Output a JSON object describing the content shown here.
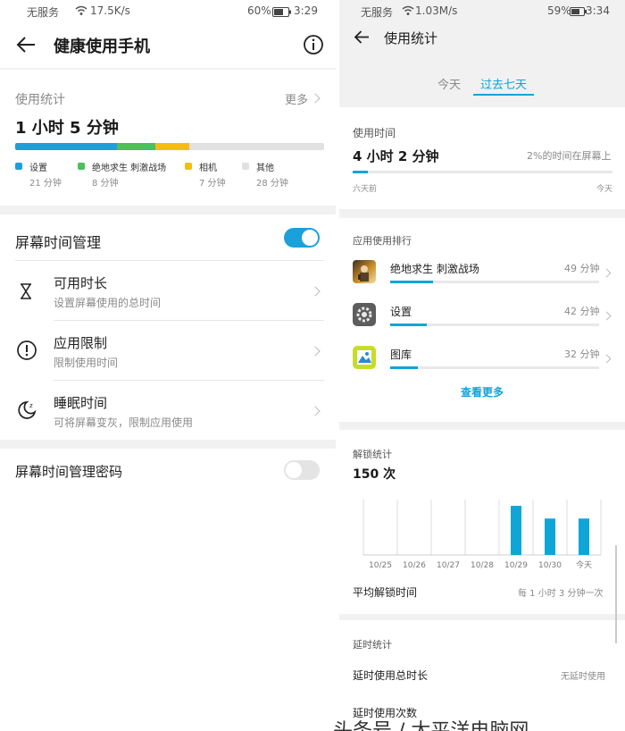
{
  "left": {
    "status_bar": {
      "carrier": "无服务",
      "speed": "17.5K/s",
      "battery": "60%",
      "time": "3:29"
    },
    "header": {
      "title": "健康使用手机"
    },
    "usage": {
      "label": "使用统计",
      "more": "更多",
      "total": "1 小时 5 分钟",
      "segments": [
        {
          "name": "设置",
          "minutes_label": "21 分钟",
          "minutes": 21,
          "color": "#1ba0dc"
        },
        {
          "name": "绝地求生 刺激战场",
          "minutes_label": "8 分钟",
          "minutes": 8,
          "color": "#4cc05a"
        },
        {
          "name": "相机",
          "minutes_label": "7 分钟",
          "minutes": 7,
          "color": "#f1be14"
        },
        {
          "name": "其他",
          "minutes_label": "28 分钟",
          "minutes": 28,
          "color": "#e1e1e1"
        }
      ]
    },
    "screen_time": {
      "title": "屏幕时间管理",
      "enabled": true,
      "items": [
        {
          "title": "可用时长",
          "subtitle": "设置屏幕使用的总时间",
          "icon": "hourglass-icon"
        },
        {
          "title": "应用限制",
          "subtitle": "限制使用时间",
          "icon": "alert-circle-icon"
        },
        {
          "title": "睡眠时间",
          "subtitle": "可将屏幕变灰，限制应用使用",
          "icon": "moon-icon"
        }
      ]
    },
    "password": {
      "title": "屏幕时间管理密码",
      "enabled": false
    }
  },
  "right": {
    "status_bar": {
      "carrier": "无服务",
      "speed": "1.03M/s",
      "battery": "59%",
      "time": "3:34"
    },
    "header": {
      "title": "使用统计"
    },
    "tabs": [
      {
        "label": "今天",
        "active": false
      },
      {
        "label": "过去七天",
        "active": true
      }
    ],
    "usage_time": {
      "label": "使用时间",
      "total": "4 小时 2 分钟",
      "percent_text": "2%的时间在屏幕上",
      "percent": 2,
      "start_label": "六天前",
      "end_label": "今天"
    },
    "ranking": {
      "label": "应用使用排行",
      "apps": [
        {
          "name": "绝地求生 刺激战场",
          "time": "49 分钟",
          "minutes": 49,
          "icon": "game-app-icon"
        },
        {
          "name": "设置",
          "time": "42 分钟",
          "minutes": 42,
          "icon": "settings-app-icon"
        },
        {
          "name": "图库",
          "time": "32 分钟",
          "minutes": 32,
          "icon": "gallery-app-icon"
        }
      ],
      "see_more": "查看更多"
    },
    "unlock": {
      "label": "解锁统计",
      "count": "150 次",
      "avg_label": "平均解锁时间",
      "avg_value": "每 1 小时 3 分钟一次"
    },
    "delay": {
      "label": "延时统计",
      "total_label": "延时使用总时长",
      "total_value": "无延时使用",
      "count_label": "延时使用次数"
    }
  },
  "watermark": {
    "text": "头条号 / 太平洋电脑网"
  },
  "colors": {
    "accent": "#0ea5d7",
    "toggle_on": "#1ba0dc"
  },
  "chart_data": {
    "type": "bar",
    "categories": [
      "10/25",
      "10/26",
      "10/27",
      "10/28",
      "10/29",
      "10/30",
      "今天"
    ],
    "values": [
      0,
      0,
      0,
      0,
      62,
      46,
      46
    ],
    "ylim": [
      0,
      70
    ],
    "grid": true
  }
}
